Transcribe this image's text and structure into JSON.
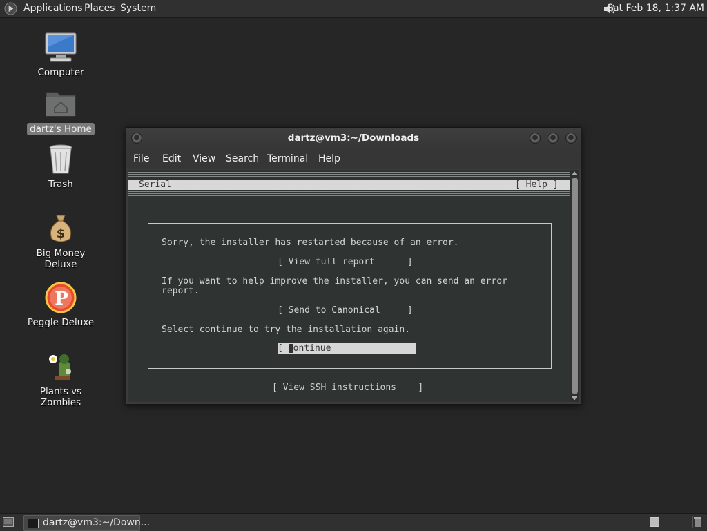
{
  "top_panel": {
    "menus": [
      "Applications",
      "Places",
      "System"
    ],
    "clock": "Sat Feb 18,  1:37 AM"
  },
  "desktop": {
    "icons": [
      {
        "label": "Computer",
        "icon": "computer-icon"
      },
      {
        "label": "dartz's Home",
        "icon": "home-folder-icon",
        "selected": true
      },
      {
        "label": "Trash",
        "icon": "trash-icon"
      },
      {
        "label": "Big Money Deluxe",
        "icon": "money-bag-icon"
      },
      {
        "label": "Peggle Deluxe",
        "icon": "peggle-icon"
      },
      {
        "label": "Plants vs Zombies",
        "icon": "plants-icon"
      }
    ]
  },
  "window": {
    "title": "dartz@vm3:~/Downloads",
    "menu": [
      "File",
      "Edit",
      "View",
      "Search",
      "Terminal",
      "Help"
    ]
  },
  "terminal": {
    "header_left": "Serial",
    "header_right": "[ Help ]",
    "line1": "Sorry, the installer has restarted because of an error.",
    "view_report": "[ View full report      ]",
    "line2a": "If you want to help improve the installer, you can send an error",
    "line2b": "report.",
    "send": "[ Send to Canonical     ]",
    "line3": "Select continue to try the installation again.",
    "continue_open": "[ ",
    "continue_label": "ontinue",
    "continue_close": "                  ]",
    "ssh": "[ View SSH instructions    ]"
  },
  "bottom_panel": {
    "task_label": "dartz@vm3:~/Down..."
  },
  "colors": {
    "panel": "#2f302f",
    "desktop": "#262626",
    "terminal_bg": "#2f3332",
    "highlight": "#d6d6d6"
  }
}
